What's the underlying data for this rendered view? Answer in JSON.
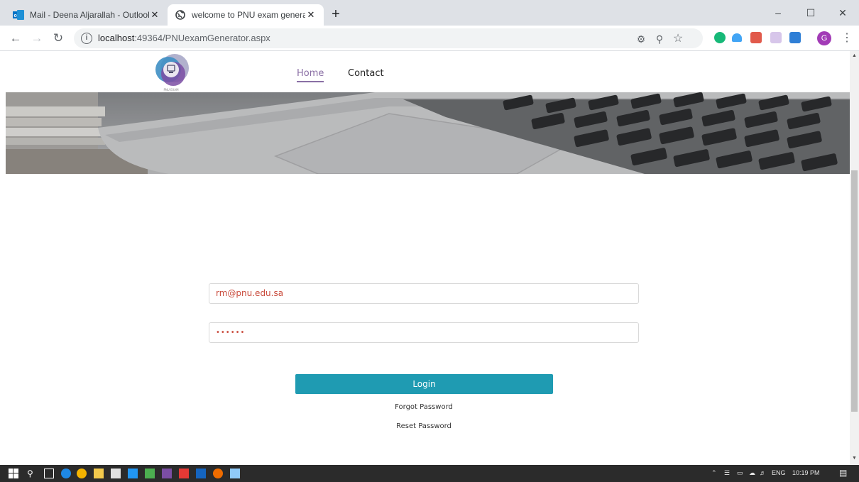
{
  "browser": {
    "tabs": [
      {
        "title": "Mail - Deena Aljarallah - Outlook",
        "favicon": "outlook-icon",
        "active": false
      },
      {
        "title": "welcome to PNU exam generator",
        "favicon": "globe-icon",
        "active": true
      }
    ],
    "close_glyph": "✕",
    "new_tab_glyph": "+",
    "url_host": "localhost",
    "url_path": ":49364/PNUexamGenerator.aspx",
    "window_controls": {
      "minimize": "–",
      "maximize": "☐",
      "close": "✕"
    },
    "profile_initial": "G"
  },
  "site": {
    "logo_text": "PNU EXAM",
    "nav": [
      {
        "label": "Home",
        "active": true
      },
      {
        "label": "Contact",
        "active": false
      }
    ]
  },
  "login_form": {
    "email_value": "rm@pnu.edu.sa",
    "password_mask": "••••••",
    "login_label": "Login",
    "forgot_label": "Forgot Password",
    "reset_label": "Reset Password"
  },
  "taskbar": {
    "language": "ENG",
    "time": "10:19 PM"
  },
  "colors": {
    "accent_teal": "#1f9bb2",
    "nav_active": "#8a6fa5",
    "input_text": "#c94a3b"
  }
}
